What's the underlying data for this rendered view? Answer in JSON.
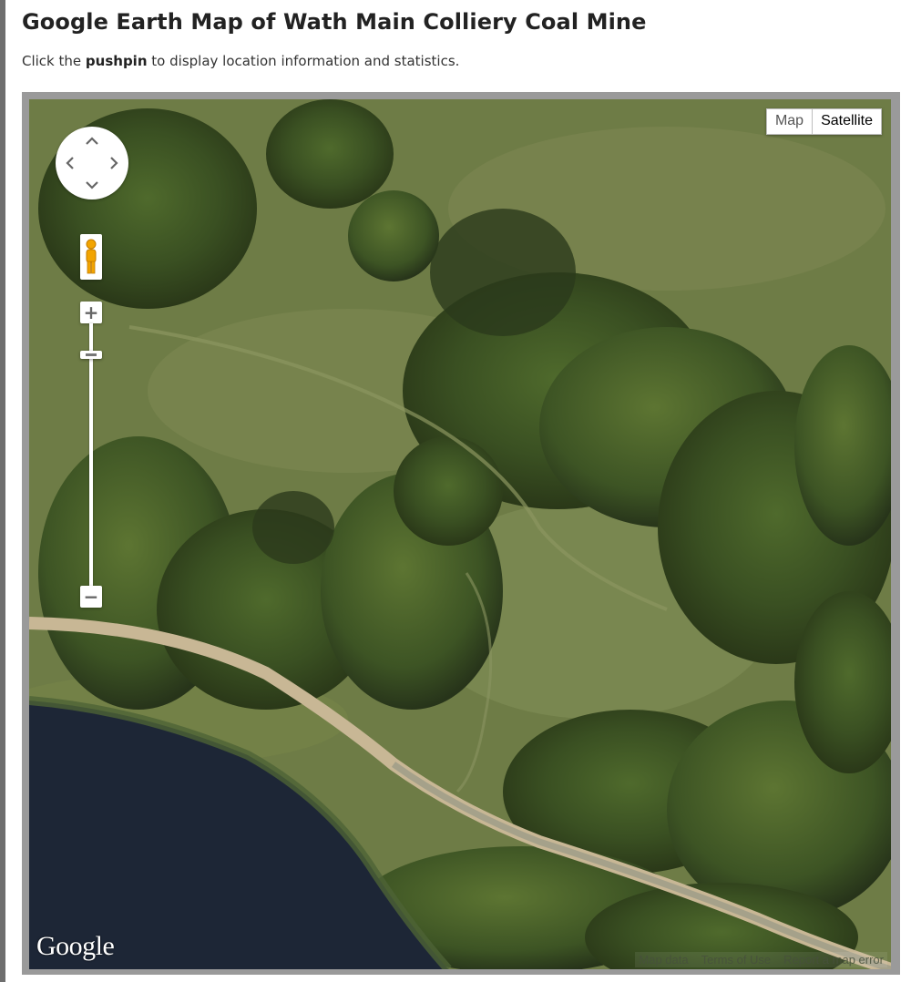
{
  "page": {
    "title": "Google Earth Map of Wath Main Colliery Coal Mine",
    "subtitle_before": "Click the",
    "subtitle_bold": "pushpin",
    "subtitle_after": "to display location information and statistics."
  },
  "map": {
    "type_control": {
      "map_label": "Map",
      "satellite_label": "Satellite",
      "selected": "Satellite"
    },
    "controls": {
      "pan_icon": "pan-arrows-icon",
      "street_view_icon": "pegman-icon",
      "zoom_in_label": "+",
      "zoom_out_label": "−"
    },
    "logo": "Google",
    "footer": {
      "map_data": "Map data",
      "terms": "Terms of Use",
      "report": "Report a map error"
    },
    "colors": {
      "grass": "#6b7a45",
      "trees": "#3b4d24",
      "water": "#1c2433",
      "path": "#c9b89a"
    }
  }
}
